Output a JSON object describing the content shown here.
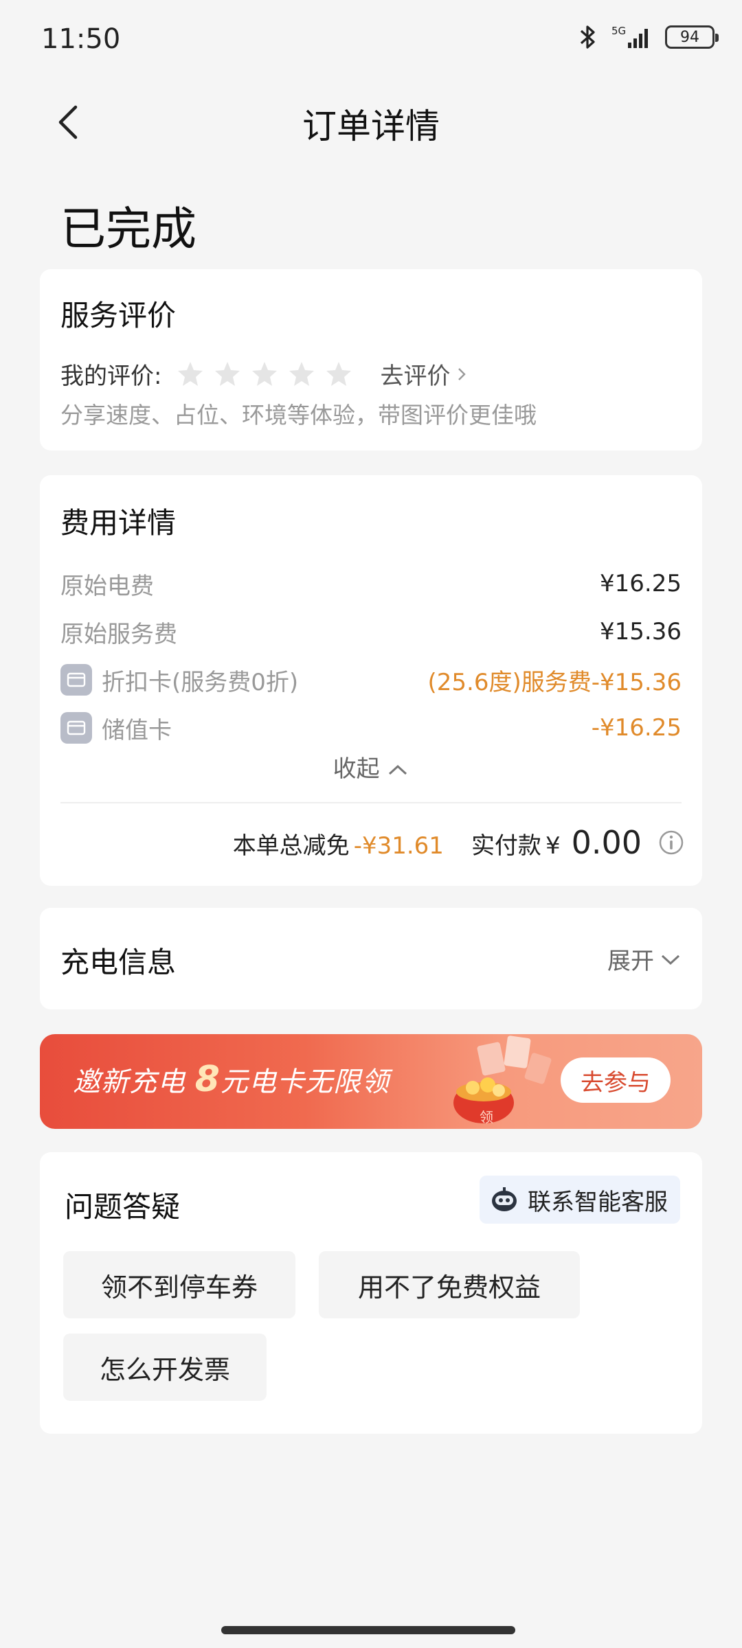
{
  "status_bar": {
    "time": "11:50",
    "network": "5G",
    "battery": "94"
  },
  "nav": {
    "title": "订单详情"
  },
  "order": {
    "status": "已完成"
  },
  "rating": {
    "title": "服务评价",
    "my_rating_label": "我的评价:",
    "stars": 0,
    "go_rate": "去评价",
    "hint": "分享速度、占位、环境等体验，带图评价更佳哦"
  },
  "fees": {
    "title": "费用详情",
    "rows": [
      {
        "label": "原始电费",
        "value": "¥16.25"
      },
      {
        "label": "原始服务费",
        "value": "¥15.36"
      },
      {
        "label": "折扣卡(服务费0折)",
        "value": "(25.6度)服务费-¥15.36"
      },
      {
        "label": "储值卡",
        "value": "-¥16.25"
      }
    ],
    "collapse": "收起",
    "total_discount_label": "本单总减免",
    "total_discount_value": "-¥31.61",
    "paid_label": "实付款",
    "paid_currency": "¥",
    "paid_value": "0.00"
  },
  "charge_info": {
    "title": "充电信息",
    "expand": "展开"
  },
  "banner": {
    "text_a": "邀新充电",
    "text_big": "8",
    "text_b": "元电卡无限领",
    "button": "去参与",
    "tag": "领"
  },
  "faq": {
    "title": "问题答疑",
    "cs_button": "联系智能客服",
    "chips": [
      "领不到停车券",
      "用不了免费权益",
      "怎么开发票"
    ]
  },
  "colors": {
    "accent_orange": "#e08a2a",
    "banner_red": "#e84d3c"
  }
}
